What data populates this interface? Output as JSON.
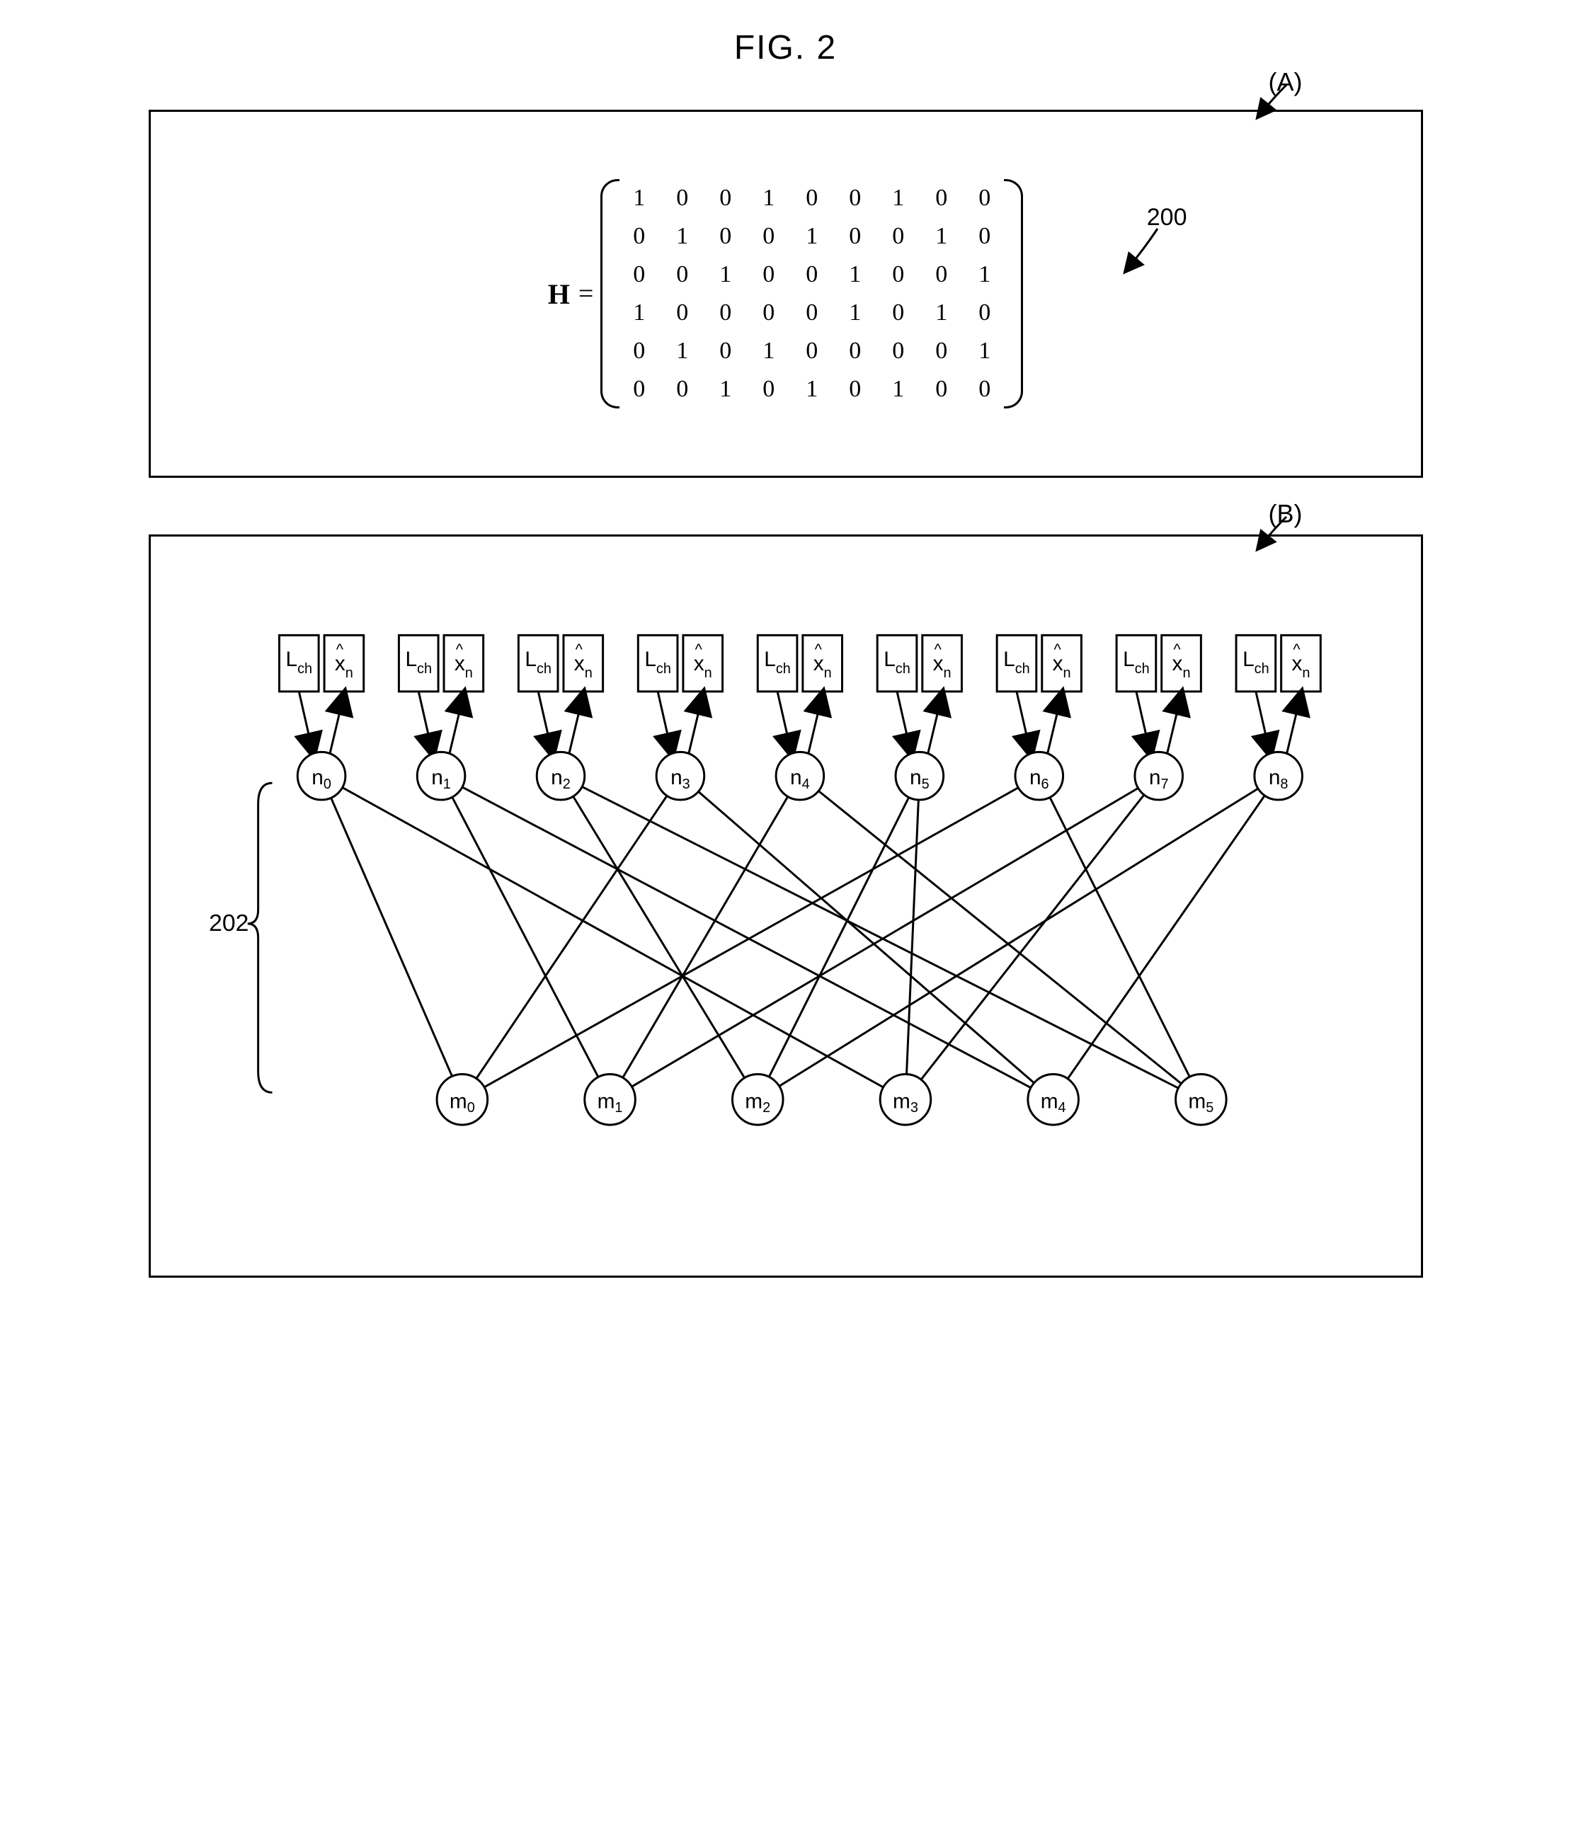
{
  "figure_title": "FIG. 2",
  "panel_a_label": "(A)",
  "panel_b_label": "(B)",
  "matrix_name": "H",
  "matrix_ref": "200",
  "matrix": [
    [
      1,
      0,
      0,
      1,
      0,
      0,
      1,
      0,
      0
    ],
    [
      0,
      1,
      0,
      0,
      1,
      0,
      0,
      1,
      0
    ],
    [
      0,
      0,
      1,
      0,
      0,
      1,
      0,
      0,
      1
    ],
    [
      1,
      0,
      0,
      0,
      0,
      1,
      0,
      1,
      0
    ],
    [
      0,
      1,
      0,
      1,
      0,
      0,
      0,
      0,
      1
    ],
    [
      0,
      0,
      1,
      0,
      1,
      0,
      1,
      0,
      0
    ]
  ],
  "panel_b_ref": "202",
  "box_Lch": "L",
  "box_Lch_sub": "ch",
  "box_xhat": "x̂",
  "box_xhat_sub": "n",
  "n_nodes": [
    "n",
    "n",
    "n",
    "n",
    "n",
    "n",
    "n",
    "n",
    "n"
  ],
  "n_subs": [
    "0",
    "1",
    "2",
    "3",
    "4",
    "5",
    "6",
    "7",
    "8"
  ],
  "m_nodes": [
    "m",
    "m",
    "m",
    "m",
    "m",
    "m"
  ],
  "m_subs": [
    "0",
    "1",
    "2",
    "3",
    "4",
    "5"
  ],
  "chart_data": {
    "type": "bipartite-graph",
    "matrix_H_rows": 6,
    "matrix_H_cols": 9,
    "variable_nodes": [
      "n0",
      "n1",
      "n2",
      "n3",
      "n4",
      "n5",
      "n6",
      "n7",
      "n8"
    ],
    "check_nodes": [
      "m0",
      "m1",
      "m2",
      "m3",
      "m4",
      "m5"
    ],
    "edges": [
      [
        "m0",
        "n0"
      ],
      [
        "m0",
        "n3"
      ],
      [
        "m0",
        "n6"
      ],
      [
        "m1",
        "n1"
      ],
      [
        "m1",
        "n4"
      ],
      [
        "m1",
        "n7"
      ],
      [
        "m2",
        "n2"
      ],
      [
        "m2",
        "n5"
      ],
      [
        "m2",
        "n8"
      ],
      [
        "m3",
        "n0"
      ],
      [
        "m3",
        "n5"
      ],
      [
        "m3",
        "n7"
      ],
      [
        "m4",
        "n1"
      ],
      [
        "m4",
        "n3"
      ],
      [
        "m4",
        "n8"
      ],
      [
        "m5",
        "n2"
      ],
      [
        "m5",
        "n4"
      ],
      [
        "m5",
        "n6"
      ]
    ],
    "io_per_variable_node": {
      "input": "L_ch",
      "output": "x_hat_n"
    }
  }
}
